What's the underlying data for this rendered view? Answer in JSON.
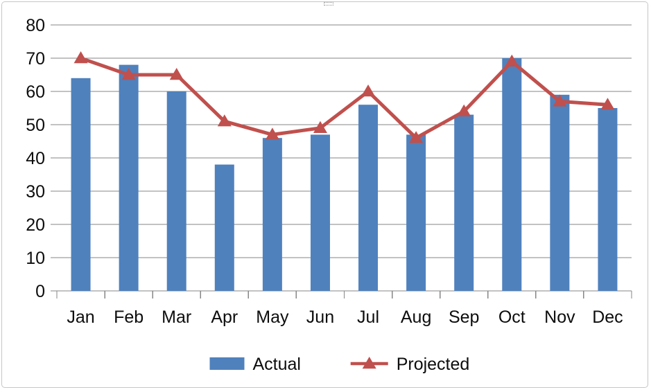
{
  "chart_data": {
    "type": "bar",
    "title": "",
    "subtitle": "",
    "xlabel": "",
    "ylabel": "",
    "categories": [
      "Jan",
      "Feb",
      "Mar",
      "Apr",
      "May",
      "Jun",
      "Jul",
      "Aug",
      "Sep",
      "Oct",
      "Nov",
      "Dec"
    ],
    "series": [
      {
        "name": "Actual",
        "type": "bar",
        "color": "#4F81BD",
        "values": [
          64,
          68,
          60,
          38,
          46,
          47,
          56,
          47,
          53,
          70,
          59,
          55
        ]
      },
      {
        "name": "Projected",
        "type": "line",
        "color": "#C0504D",
        "marker": "triangle",
        "values": [
          70,
          65,
          65,
          51,
          47,
          49,
          60,
          46,
          54,
          69,
          57,
          56
        ]
      }
    ],
    "ylim": [
      0,
      80
    ],
    "y_ticks": [
      0,
      10,
      20,
      30,
      40,
      50,
      60,
      70,
      80
    ],
    "y_tick_labels": [
      "0",
      "10",
      "20",
      "30",
      "40",
      "50",
      "60",
      "70",
      "80"
    ],
    "grid": {
      "horizontal": true,
      "vertical": false,
      "color": "#868686"
    },
    "legend": {
      "position": "bottom",
      "entries": [
        {
          "label": "Actual",
          "marker": "rect",
          "color": "#4F81BD"
        },
        {
          "label": "Projected",
          "marker": "line-triangle",
          "color": "#C0504D"
        }
      ]
    },
    "axis_color": "#868686",
    "plot_background": "#FFFFFF"
  },
  "frame": {
    "border_color": "#C6C6C6",
    "background": "#FFFFFF"
  }
}
